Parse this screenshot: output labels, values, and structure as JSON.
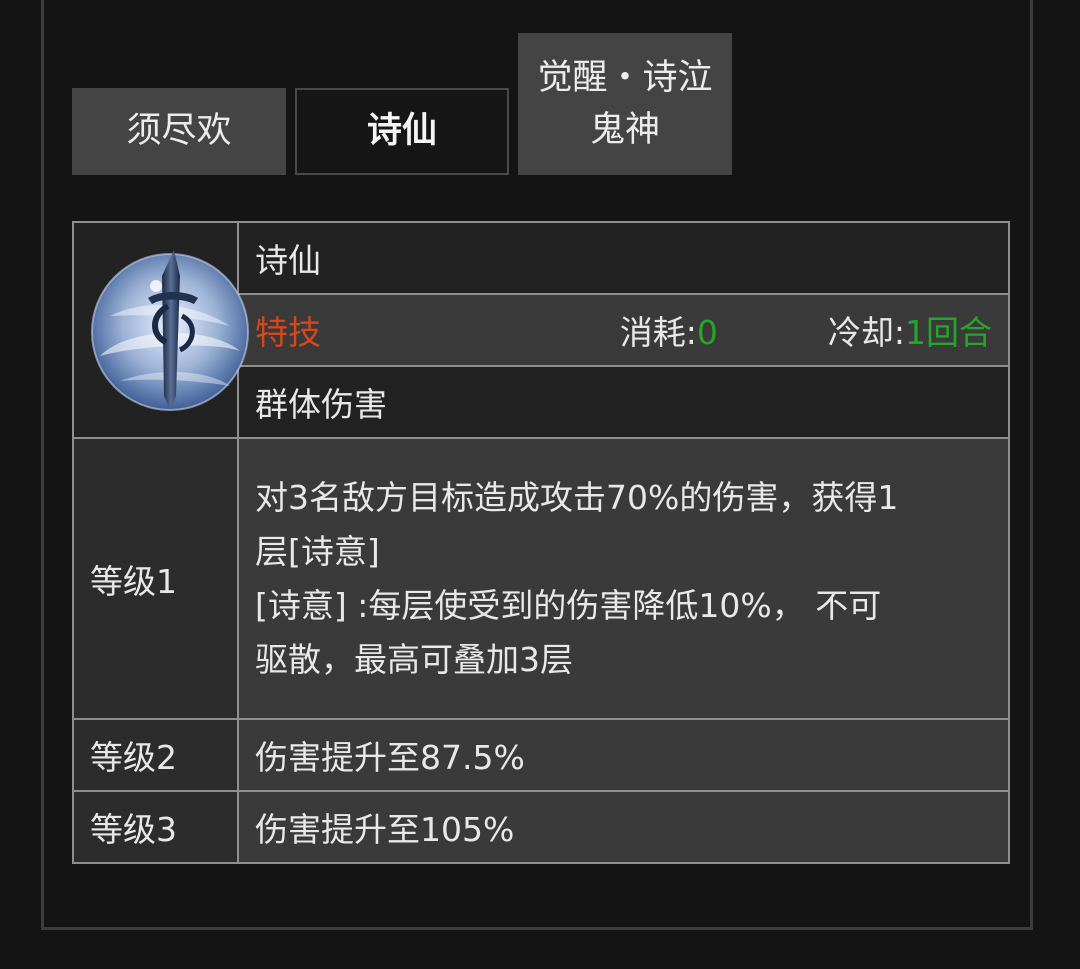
{
  "tabs": [
    {
      "label": "须尽欢",
      "active": false
    },
    {
      "label": "诗仙",
      "active": true
    },
    {
      "label_line1": "觉醒・诗泣",
      "label_line2": "鬼神",
      "active": false
    }
  ],
  "skill": {
    "icon": "sword-orb-icon",
    "name": "诗仙",
    "tag": "特技",
    "cost_label": "消耗:",
    "cost_value": "0",
    "cooldown_label": "冷却:",
    "cooldown_value": "1回合",
    "category": "群体伤害",
    "levels": [
      {
        "label": "等级1",
        "lines": [
          "对3名敌方目标造成攻击70%的伤害，获得1",
          "层[诗意]",
          "[诗意] :每层使受到的伤害降低10%， 不可",
          "驱散，最高可叠加3层"
        ]
      },
      {
        "label": "等级2",
        "text": "伤害提升至87.5%"
      },
      {
        "label": "等级3",
        "text": "伤害提升至105%"
      }
    ]
  },
  "colors": {
    "tag": "#d5471d",
    "highlight_number": "#25a52a",
    "background": "#141414",
    "border": "#8f8f8f"
  }
}
